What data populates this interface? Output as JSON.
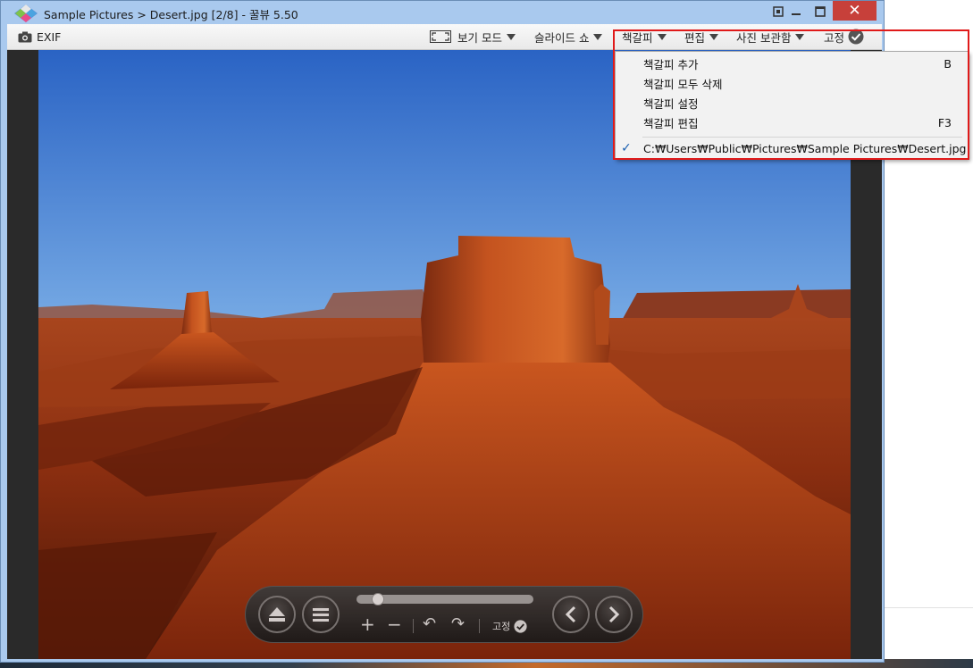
{
  "window": {
    "title": "Sample Pictures > Desert.jpg [2/8] - 꿀뷰 5.50"
  },
  "toolbar": {
    "exif_label": "EXIF",
    "view_mode_label": "보기 모드",
    "slideshow_label": "슬라이드 쇼",
    "bookmark_label": "책갈피",
    "edit_label": "편집",
    "photo_library_label": "사진 보관함",
    "pin_label": "고정"
  },
  "bookmark_menu": {
    "items": [
      {
        "label": "책갈피 추가",
        "shortcut": "B"
      },
      {
        "label": "책갈피 모두 삭제",
        "shortcut": ""
      },
      {
        "label": "책갈피 설정",
        "shortcut": ""
      },
      {
        "label": "책갈피 편집",
        "shortcut": "F3"
      }
    ],
    "bookmarked_path": "C:₩Users₩Public₩Pictures₩Sample Pictures₩Desert.jpg",
    "checked": true
  },
  "controls": {
    "pin_label": "고정",
    "progress": 0.12
  },
  "colors": {
    "titlebar": "#a9c9ee",
    "close_button": "#c7403a",
    "highlight": "#e01a1a"
  }
}
